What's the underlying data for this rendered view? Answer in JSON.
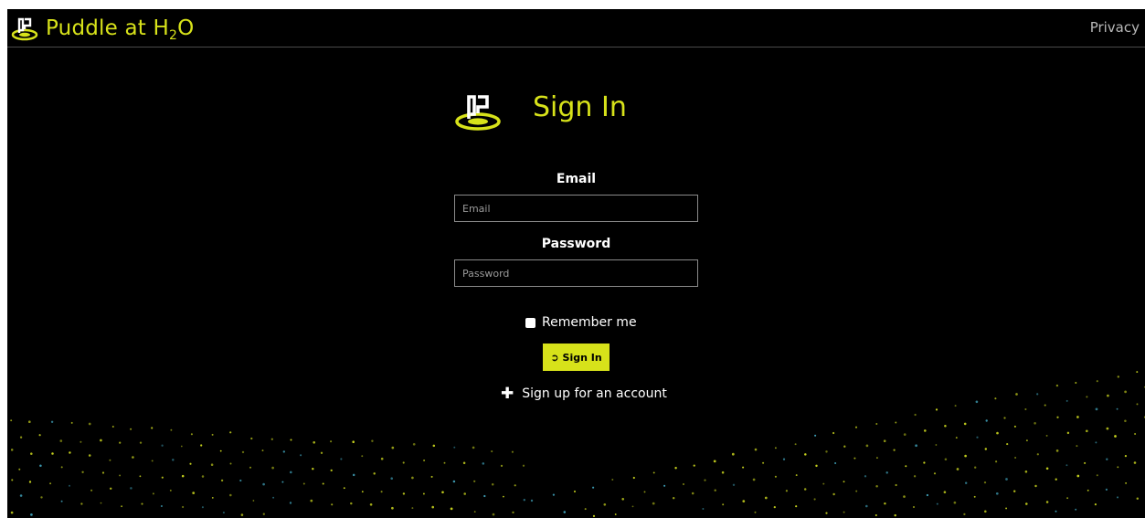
{
  "navbar": {
    "brand_name": "Puddle at H",
    "brand_sub": "2",
    "brand_suffix": "O",
    "privacy_label": "Privacy"
  },
  "main": {
    "title": "Sign In",
    "email_label": "Email",
    "email_placeholder": "Email",
    "email_value": "",
    "password_label": "Password",
    "password_placeholder": "Password",
    "password_value": "",
    "remember_label": "Remember me",
    "remember_checked": false,
    "signin_button_label": "Sign In",
    "signin_button_icon": "sign-in-icon",
    "signup_label": "Sign up for an account",
    "signup_icon": "plus-icon"
  },
  "colors": {
    "accent": "#d7e21a",
    "background": "#000000",
    "text": "#ffffff",
    "dots_yellow": "#c9d41e",
    "dots_blue": "#3fa0b8"
  }
}
